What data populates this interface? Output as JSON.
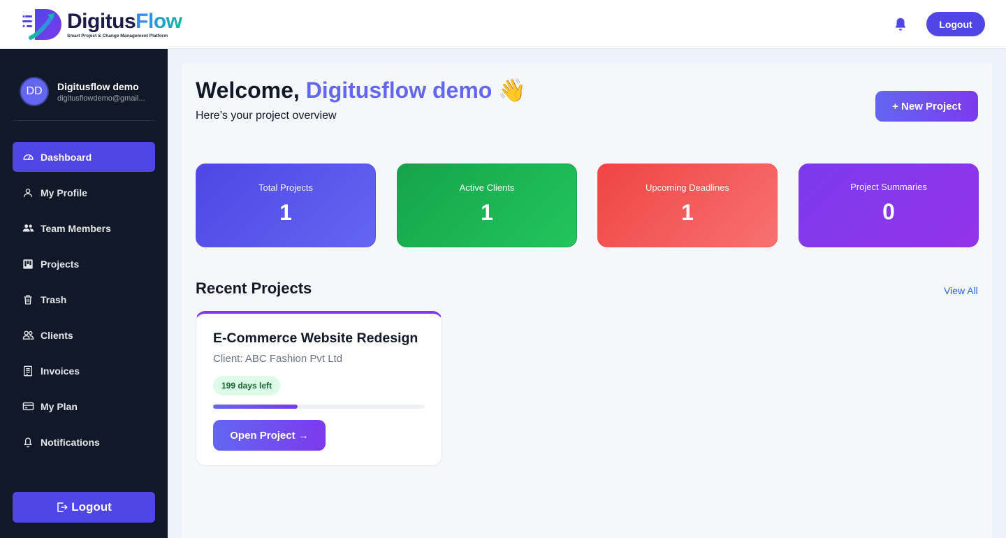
{
  "brand": {
    "name_part1": "Digitus",
    "name_part2": "Flow",
    "tagline": "Smart Project & Change Management Platform"
  },
  "header": {
    "notification_icon": "bell-icon",
    "logout_label": "Logout"
  },
  "sidebar": {
    "user": {
      "initials": "DD",
      "name": "Digitusflow demo",
      "email": "digitusflowdemo@gmail..."
    },
    "items": [
      {
        "label": "Dashboard",
        "icon": "gauge-icon",
        "active": true
      },
      {
        "label": "My Profile",
        "icon": "user-icon",
        "active": false
      },
      {
        "label": "Team Members",
        "icon": "users-icon",
        "active": false
      },
      {
        "label": "Projects",
        "icon": "kanban-icon",
        "active": false
      },
      {
        "label": "Trash",
        "icon": "trash-icon",
        "active": false
      },
      {
        "label": "Clients",
        "icon": "people-icon",
        "active": false
      },
      {
        "label": "Invoices",
        "icon": "invoice-icon",
        "active": false
      },
      {
        "label": "My Plan",
        "icon": "credit-card-icon",
        "active": false
      },
      {
        "label": "Notifications",
        "icon": "bell-icon",
        "active": false
      }
    ],
    "logout_label": "Logout"
  },
  "main": {
    "welcome_prefix": "Welcome,",
    "welcome_name": "Digitusflow demo",
    "welcome_emoji": "👋",
    "subtitle": "Here’s your project overview",
    "new_project_label": "+ New Project",
    "stats": [
      {
        "label": "Total Projects",
        "value": "1",
        "color": "#4f46e5"
      },
      {
        "label": "Active Clients",
        "value": "1",
        "color": "#16a34a"
      },
      {
        "label": "Upcoming Deadlines",
        "value": "1",
        "color": "#ef4444"
      },
      {
        "label": "Project Summaries",
        "value": "0",
        "color": "#7c3aed"
      }
    ],
    "recent_title": "Recent Projects",
    "view_all_label": "View All",
    "projects": [
      {
        "name": "E-Commerce Website Redesign",
        "client": "Client: ABC Fashion Pvt Ltd",
        "days_left": "199 days left",
        "progress_fraction": 0.4,
        "open_label": "Open Project →"
      }
    ]
  },
  "colors": {
    "accent": "#4f46e5",
    "sidebar_bg": "#111827",
    "link": "#2563eb"
  }
}
